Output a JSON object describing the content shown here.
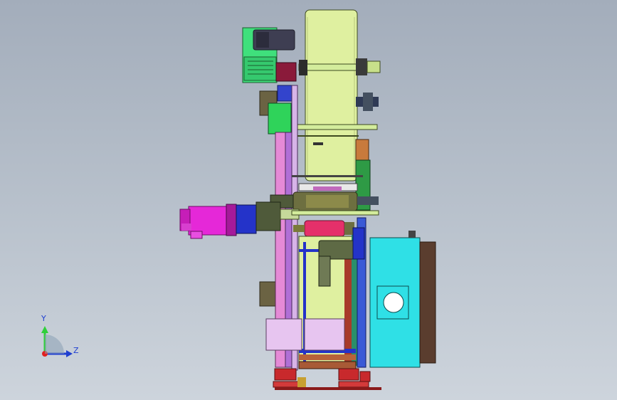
{
  "triad": {
    "y_label": "Y",
    "z_label": "Z"
  },
  "colors": {
    "background_top": "#a3adbb",
    "background_bottom": "#cdd4dc",
    "drum": "#dff0a0",
    "frame_pink": "#e58ad6",
    "motor_magenta": "#e528d8",
    "motor_blue": "#2433c9",
    "enclosure_cyan": "#2fe0e6",
    "panel_brown": "#5a3d2e",
    "green_box": "#2fd35a",
    "spring_green": "#3fe07c",
    "lavender": "#e7c5f0",
    "olive": "#7a7a3a"
  }
}
